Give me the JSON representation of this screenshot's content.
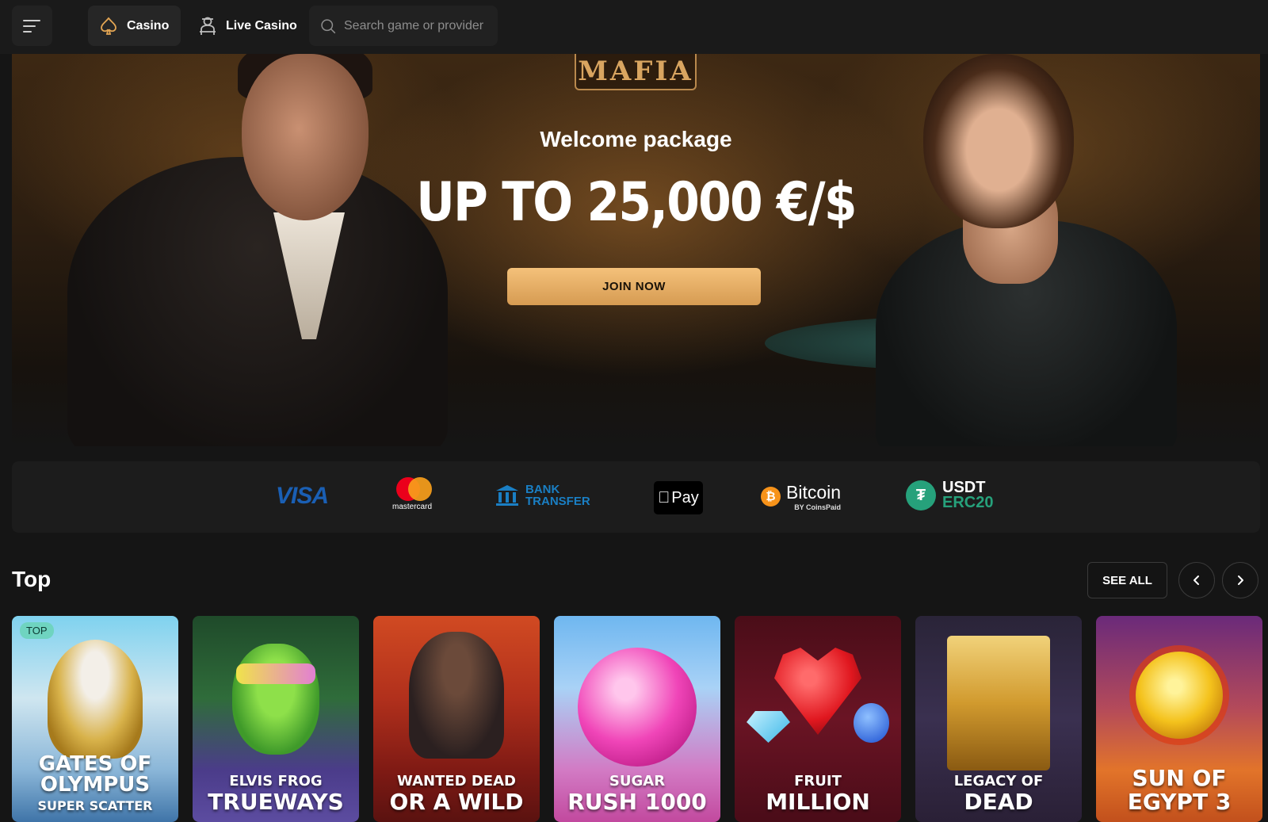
{
  "header": {
    "tabs": [
      {
        "label": "Casino",
        "icon": "spade-icon",
        "active": true
      },
      {
        "label": "Live Casino",
        "icon": "dealer-icon",
        "active": false
      }
    ],
    "search": {
      "placeholder": "Search game or provider"
    }
  },
  "hero": {
    "logo": "MAFIA",
    "welcome": "Welcome package",
    "amount": "UP TO 25,000 €/$",
    "cta": "JOIN NOW"
  },
  "payments": {
    "visa": "VISA",
    "mastercard": "mastercard",
    "bank_line1": "BANK",
    "bank_line2": "TRANSFER",
    "applepay": "Pay",
    "bitcoin": "Bitcoin",
    "bitcoin_by": "BY CoinsPaid",
    "usdt_line1": "USDT",
    "usdt_line2": "ERC20"
  },
  "top": {
    "title": "Top",
    "see_all": "SEE ALL",
    "games": [
      {
        "line1": "GATES OF",
        "line2": "OLYMPUS",
        "line3": "SUPER SCATTER",
        "badge": "TOP"
      },
      {
        "line1": "ELVIS FROG",
        "line2": "TRUEWAYS"
      },
      {
        "line1": "WANTED DEAD",
        "line2": "OR A WILD"
      },
      {
        "line1": "SUGAR",
        "line2": "RUSH 1000"
      },
      {
        "line1": "FRUIT",
        "line2": "MILLION"
      },
      {
        "line1": "LEGACY OF",
        "line2": "DEAD"
      },
      {
        "line1": "SUN OF",
        "line2": "EGYPT 3"
      }
    ]
  },
  "colors": {
    "accent_gold": "#f4c17a",
    "background": "#151515",
    "top_badge": "#6fd4c0"
  }
}
